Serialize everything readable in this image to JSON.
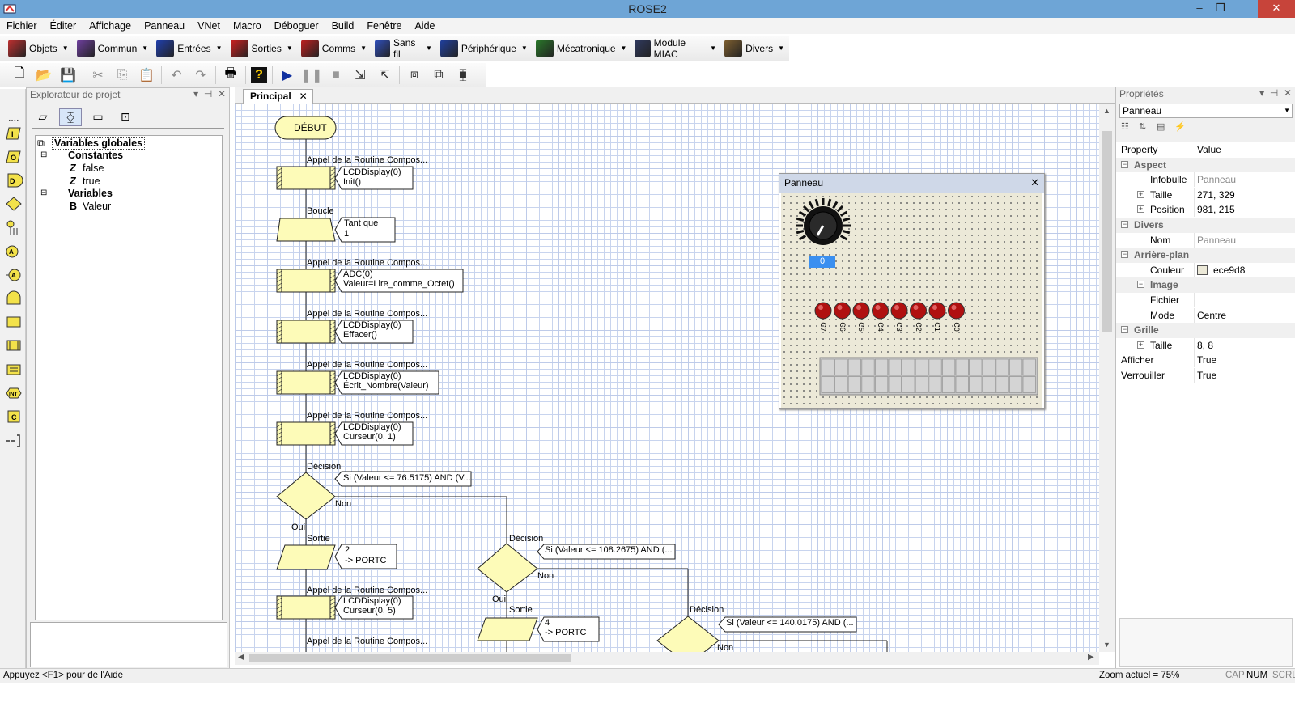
{
  "window": {
    "title": "ROSE2"
  },
  "menu": [
    "Fichier",
    "Éditer",
    "Affichage",
    "Panneau",
    "VNet",
    "Macro",
    "Déboguer",
    "Build",
    "Fenêtre",
    "Aide"
  ],
  "component_toolbar": [
    {
      "label": "Objets",
      "icon": "objects-icon",
      "color": "#c03030"
    },
    {
      "label": "Commun",
      "icon": "cube-icon",
      "color": "#7040a0"
    },
    {
      "label": "Entrées",
      "icon": "input-chip-icon",
      "color": "#2040b0"
    },
    {
      "label": "Sorties",
      "icon": "output-chip-icon",
      "color": "#d02020"
    },
    {
      "label": "Comms",
      "icon": "comms-icon",
      "color": "#c02020"
    },
    {
      "label": "Sans fil",
      "icon": "wireless-icon",
      "color": "#3050c0"
    },
    {
      "label": "Périphérique",
      "icon": "peripheral-icon",
      "color": "#2040a0"
    },
    {
      "label": "Mécatronique",
      "icon": "mechatronics-icon",
      "color": "#2a7a2a"
    },
    {
      "label": "Module MIAC",
      "icon": "miac-icon",
      "color": "#303a60"
    },
    {
      "label": "Divers",
      "icon": "misc-tools-icon",
      "color": "#806030"
    }
  ],
  "explorer": {
    "title": "Explorateur de projet",
    "tree": {
      "root": "Variables globales",
      "constants_label": "Constantes",
      "constants": [
        "false",
        "true"
      ],
      "variables_label": "Variables",
      "variables": [
        "Valeur"
      ]
    }
  },
  "tab": {
    "label": "Principal"
  },
  "flowchart": {
    "start": "DÉBUT",
    "call_label": "Appel de la Routine Compos...",
    "loop_label": "Boucle",
    "decision_label": "Décision",
    "output_label": "Sortie",
    "yes": "Oui",
    "no": "Non",
    "calls": [
      {
        "l1": "LCDDisplay(0)",
        "l2": "Init()"
      },
      {
        "l1": "ADC(0)",
        "l2": "Valeur=Lire_comme_Octet()"
      },
      {
        "l1": "LCDDisplay(0)",
        "l2": "Effacer()"
      },
      {
        "l1": "LCDDisplay(0)",
        "l2": "Écrit_Nombre(Valeur)"
      },
      {
        "l1": "LCDDisplay(0)",
        "l2": "Curseur(0, 1)"
      },
      {
        "l1": "LCDDisplay(0)",
        "l2": "Curseur(0, 5)"
      }
    ],
    "loop": {
      "l1": "Tant que",
      "l2": "1"
    },
    "decisions": [
      "Si (Valeur <= 76.5175) AND (V...",
      "Si (Valeur <= 108.2675) AND (...",
      "Si (Valeur <= 140.0175) AND (..."
    ],
    "outputs": [
      {
        "l1": "2",
        "l2": "-> PORTC"
      },
      {
        "l1": "4",
        "l2": "-> PORTC"
      }
    ]
  },
  "panel_window": {
    "title": "Panneau",
    "knob_value": "0",
    "leds": [
      "C7",
      "C6",
      "C5",
      "C4",
      "C3",
      "C2",
      "C1",
      "C0"
    ],
    "led_color": "#b01010",
    "lcd_columns": 16,
    "lcd_rows": 2
  },
  "properties": {
    "title": "Propriétés",
    "selected": "Panneau",
    "col_property": "Property",
    "col_value": "Value",
    "rows": [
      {
        "type": "cat",
        "name": "Aspect"
      },
      {
        "type": "prop",
        "name": "Infobulle",
        "value": "Panneau",
        "grey": true
      },
      {
        "type": "prop",
        "name": "Taille",
        "value": "271, 329",
        "expander": true
      },
      {
        "type": "prop",
        "name": "Position",
        "value": "981, 215",
        "expander": true
      },
      {
        "type": "cat",
        "name": "Divers"
      },
      {
        "type": "prop",
        "name": "Nom",
        "value": "Panneau",
        "grey": true
      },
      {
        "type": "cat",
        "name": "Arrière-plan"
      },
      {
        "type": "prop",
        "name": "Couleur",
        "value": "ece9d8",
        "swatch": "#ece9d8"
      },
      {
        "type": "subcat",
        "name": "Image"
      },
      {
        "type": "prop2",
        "name": "Fichier",
        "value": ""
      },
      {
        "type": "prop2",
        "name": "Mode",
        "value": "Centre"
      },
      {
        "type": "cat",
        "name": "Grille"
      },
      {
        "type": "prop",
        "name": "Taille",
        "value": "8, 8",
        "expander": true
      },
      {
        "type": "prop0",
        "name": "Afficher",
        "value": "True"
      },
      {
        "type": "prop0",
        "name": "Verrouiller",
        "value": "True"
      }
    ]
  },
  "status": {
    "help": "Appuyez <F1> pour de l'Aide",
    "zoom": "Zoom actuel = 75%",
    "indicators": [
      {
        "label": "CAP",
        "on": false
      },
      {
        "label": "NUM",
        "on": true
      },
      {
        "label": "SCRL",
        "on": false
      }
    ]
  }
}
